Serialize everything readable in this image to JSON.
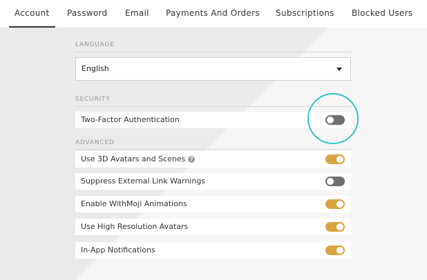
{
  "tabs": [
    {
      "label": "Account",
      "active": true
    },
    {
      "label": "Password"
    },
    {
      "label": "Email"
    },
    {
      "label": "Payments And Orders"
    },
    {
      "label": "Subscriptions"
    },
    {
      "label": "Blocked Users"
    }
  ],
  "language": {
    "section_label": "LANGUAGE",
    "selected": "English"
  },
  "security": {
    "section_label": "SECURITY",
    "two_factor": {
      "label": "Two-Factor Authentication",
      "enabled": false
    }
  },
  "advanced": {
    "section_label": "ADVANCED",
    "settings": [
      {
        "label": "Use 3D Avatars and Scenes",
        "enabled": true,
        "help_icon": "question-circle-icon"
      },
      {
        "label": "Suppress External Link Warnings",
        "enabled": false
      },
      {
        "label": "Enable WithMoji Animations",
        "enabled": true
      },
      {
        "label": "Use High Resolution Avatars",
        "enabled": true
      },
      {
        "label": "In-App Notifications",
        "enabled": true
      }
    ]
  },
  "colors": {
    "toggle_on": "#d9a441",
    "toggle_off": "#707070",
    "highlight_ring": "#2ec4c8",
    "active_tab_underline": "#333333"
  }
}
